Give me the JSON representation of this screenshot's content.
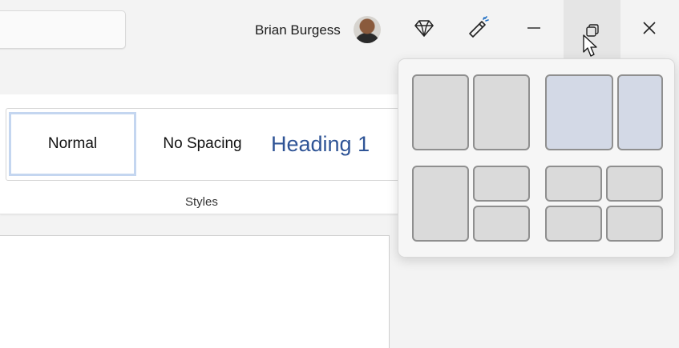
{
  "titlebar": {
    "user_name": "Brian Burgess",
    "icons": [
      "diamond-icon",
      "brush-icon",
      "minimize-icon",
      "restore-icon",
      "close-icon"
    ]
  },
  "ribbon": {
    "styles": {
      "items": [
        "Normal",
        "No Spacing",
        "Heading 1"
      ],
      "selected": "Normal",
      "group_label": "Styles"
    }
  },
  "snap_layouts": {
    "layouts": [
      "two-column-equal",
      "two-column-wide-left",
      "three-zone",
      "four-grid"
    ],
    "highlighted_layout": "two-column-wide-left"
  },
  "colors": {
    "heading_blue": "#2f5496",
    "selection_border": "#c4d6f0",
    "restore_hover": "#e5e5e5"
  }
}
